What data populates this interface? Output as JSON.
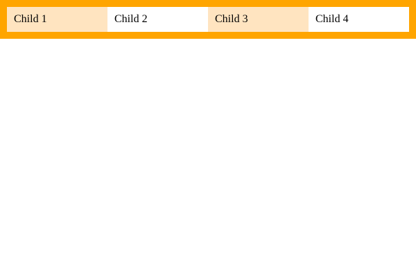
{
  "colors": {
    "container_background": "#ffa500",
    "odd_child_background": "#ffe4c0",
    "even_child_background": "#ffffff"
  },
  "children": [
    {
      "label": "Child 1"
    },
    {
      "label": "Child 2"
    },
    {
      "label": "Child 3"
    },
    {
      "label": "Child 4"
    }
  ]
}
